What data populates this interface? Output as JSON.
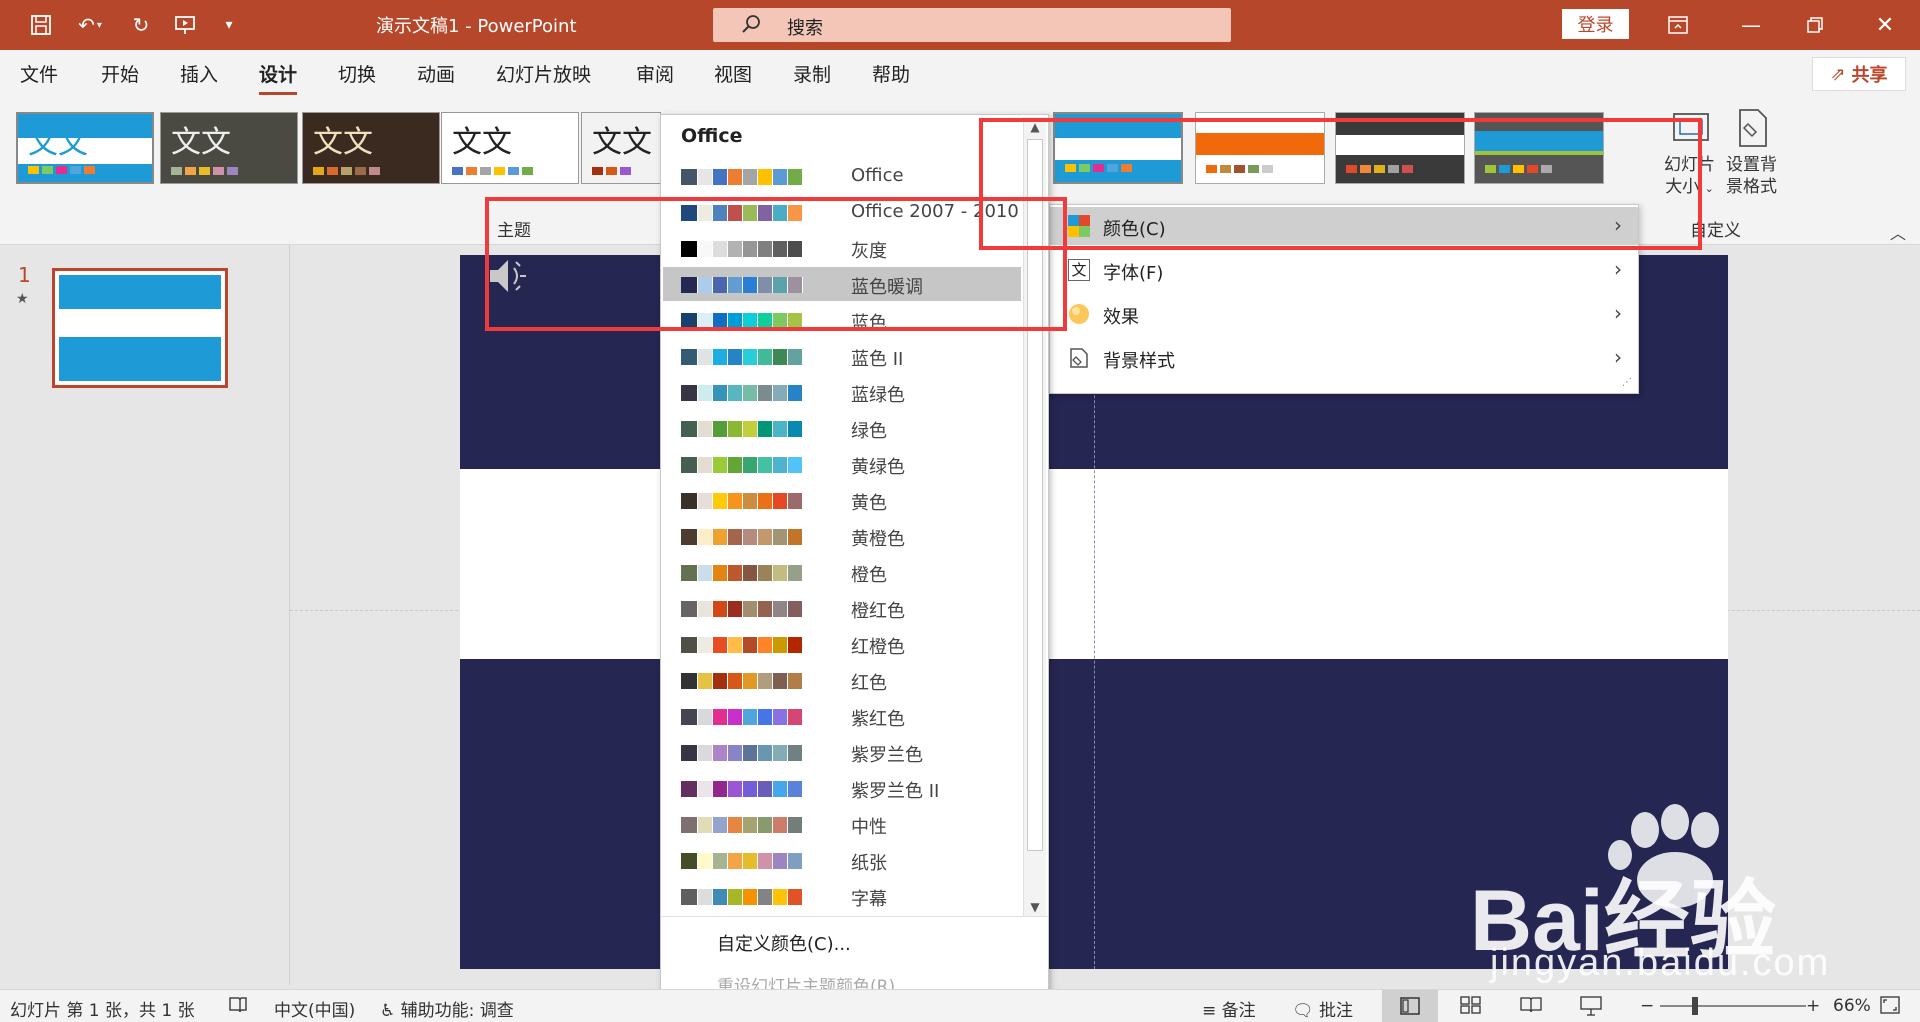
{
  "titlebar": {
    "doc_title": "演示文稿1  -  PowerPoint",
    "search_placeholder": "搜索",
    "login": "登录"
  },
  "tabs": [
    "文件",
    "开始",
    "插入",
    "设计",
    "切换",
    "动画",
    "幻灯片放映",
    "审阅",
    "视图",
    "录制",
    "帮助"
  ],
  "active_tab": "设计",
  "share_label": "共享",
  "ribbon": {
    "theme_group_label": "主题",
    "theme_thumb_text": "文文",
    "slide_size_label_1": "幻灯片",
    "slide_size_label_2": "大小",
    "format_bg_label_1": "设置背",
    "format_bg_label_2": "景格式",
    "customize_group_label": "自定义"
  },
  "slides_panel": {
    "slide_number": "1"
  },
  "color_menu": {
    "header": "Office",
    "items": [
      {
        "label": "Office",
        "swatches": [
          "#44546a",
          "#e7e6e6",
          "#4472c4",
          "#ed7d31",
          "#a5a5a5",
          "#ffc000",
          "#5b9bd5",
          "#70ad47"
        ]
      },
      {
        "label": "Office 2007 - 2010",
        "swatches": [
          "#1f497d",
          "#eeece1",
          "#4f81bd",
          "#c0504d",
          "#9bbb59",
          "#8064a2",
          "#4bacc6",
          "#f79646"
        ]
      },
      {
        "label": "灰度",
        "swatches": [
          "#000000",
          "#f8f8f8",
          "#dddddd",
          "#b2b2b2",
          "#969696",
          "#808080",
          "#5f5f5f",
          "#4d4d4d"
        ]
      },
      {
        "label": "蓝色暖调",
        "swatches": [
          "#242852",
          "#acccea",
          "#4a66ac",
          "#629dd1",
          "#297fd5",
          "#7f8fa9",
          "#5aa2ae",
          "#9d90a0"
        ]
      },
      {
        "label": "蓝色",
        "swatches": [
          "#17406d",
          "#dbeff9",
          "#0f6fc6",
          "#009dd9",
          "#0bd0d9",
          "#10cf9b",
          "#7cca62",
          "#a5c249"
        ]
      },
      {
        "label": "蓝色 II",
        "swatches": [
          "#335b74",
          "#dfe3e5",
          "#1cade4",
          "#2683c6",
          "#27ced7",
          "#42ba97",
          "#3e8853",
          "#62a39f"
        ]
      },
      {
        "label": "蓝绿色",
        "swatches": [
          "#373545",
          "#ceecee",
          "#3494ba",
          "#58b6c0",
          "#75bda7",
          "#7a8c8e",
          "#84acb6",
          "#2683c6"
        ]
      },
      {
        "label": "绿色",
        "swatches": [
          "#455f51",
          "#e3ded1",
          "#549e39",
          "#8ab833",
          "#c0cf3a",
          "#029676",
          "#4ab5c4",
          "#0989b1"
        ]
      },
      {
        "label": "黄绿色",
        "swatches": [
          "#455f51",
          "#e3ded1",
          "#99cb38",
          "#63a537",
          "#37a76f",
          "#44c1a3",
          "#4eb3cf",
          "#51c3f9"
        ]
      },
      {
        "label": "黄色",
        "swatches": [
          "#39302a",
          "#e5dedb",
          "#ffca08",
          "#f8931d",
          "#ce8d3e",
          "#ec7016",
          "#e64823",
          "#9c6a6a"
        ]
      },
      {
        "label": "黄橙色",
        "swatches": [
          "#4e3b30",
          "#fbeec9",
          "#f0a22e",
          "#a5644e",
          "#b58b80",
          "#c3986d",
          "#a19574",
          "#c17529"
        ]
      },
      {
        "label": "橙色",
        "swatches": [
          "#637052",
          "#ccddea",
          "#e48312",
          "#bd582c",
          "#865640",
          "#9b8357",
          "#c2bc80",
          "#94a088"
        ]
      },
      {
        "label": "橙红色",
        "swatches": [
          "#696464",
          "#e9e5dc",
          "#d34817",
          "#9b2d1f",
          "#a28e6a",
          "#956251",
          "#918485",
          "#855d5d"
        ]
      },
      {
        "label": "红橙色",
        "swatches": [
          "#505046",
          "#eeece1",
          "#e84c22",
          "#ffbd47",
          "#b64926",
          "#ff8427",
          "#cc9900",
          "#b22600"
        ]
      },
      {
        "label": "红色",
        "swatches": [
          "#323232",
          "#e5c243",
          "#a5300f",
          "#d55816",
          "#e19825",
          "#b19c7d",
          "#7f5f52",
          "#b27d49"
        ]
      },
      {
        "label": "紫红色",
        "swatches": [
          "#454551",
          "#d8d9dc",
          "#e32d91",
          "#c830cc",
          "#4ea6dc",
          "#4775e7",
          "#8971e1",
          "#d54773"
        ]
      },
      {
        "label": "紫罗兰色",
        "swatches": [
          "#373545",
          "#dcd8dc",
          "#ad84c6",
          "#8784c7",
          "#5d739a",
          "#6997af",
          "#84acb6",
          "#6f8183"
        ]
      },
      {
        "label": "紫罗兰色 II",
        "swatches": [
          "#632e62",
          "#eae5eb",
          "#92278f",
          "#9b57d3",
          "#755dd9",
          "#665eb8",
          "#45a5ed",
          "#5982db"
        ]
      },
      {
        "label": "中性",
        "swatches": [
          "#7f6f6f",
          "#dfdcb7",
          "#96a3cc",
          "#e78543",
          "#a4a372",
          "#8a9a6f",
          "#ce7c6a",
          "#727e77"
        ]
      },
      {
        "label": "纸张",
        "swatches": [
          "#444d26",
          "#fefac9",
          "#a5b592",
          "#f3a447",
          "#e7bc29",
          "#d092a7",
          "#9c85c0",
          "#809ec2"
        ]
      },
      {
        "label": "字幕",
        "swatches": [
          "#5e5e5e",
          "#dddddd",
          "#418ab3",
          "#a6b727",
          "#f69200",
          "#838383",
          "#fec306",
          "#df5327"
        ]
      }
    ],
    "highlighted": "蓝色暖调",
    "custom_colors": "自定义颜色(C)...",
    "reset_colors": "重设幻灯片主题颜色(R)"
  },
  "submenu": {
    "items": [
      {
        "label": "颜色(C)",
        "icon": "color-palette-icon"
      },
      {
        "label": "字体(F)",
        "icon": "font-icon"
      },
      {
        "label": "效果",
        "icon": "effects-icon"
      },
      {
        "label": "背景样式",
        "icon": "background-style-icon"
      }
    ]
  },
  "statusbar": {
    "slide_info": "幻灯片 第 1 张，共 1 张",
    "language": "中文(中国)",
    "accessibility": "辅助功能: 调查",
    "notes": "备注",
    "comments": "批注",
    "zoom": "66%"
  },
  "watermark": {
    "brand": "Bai经验",
    "url": "jingyan.baidu.com"
  },
  "colors": {
    "accent": "#b7472a",
    "slide_dark": "#252652",
    "annotation_red": "#ef3b3b"
  }
}
